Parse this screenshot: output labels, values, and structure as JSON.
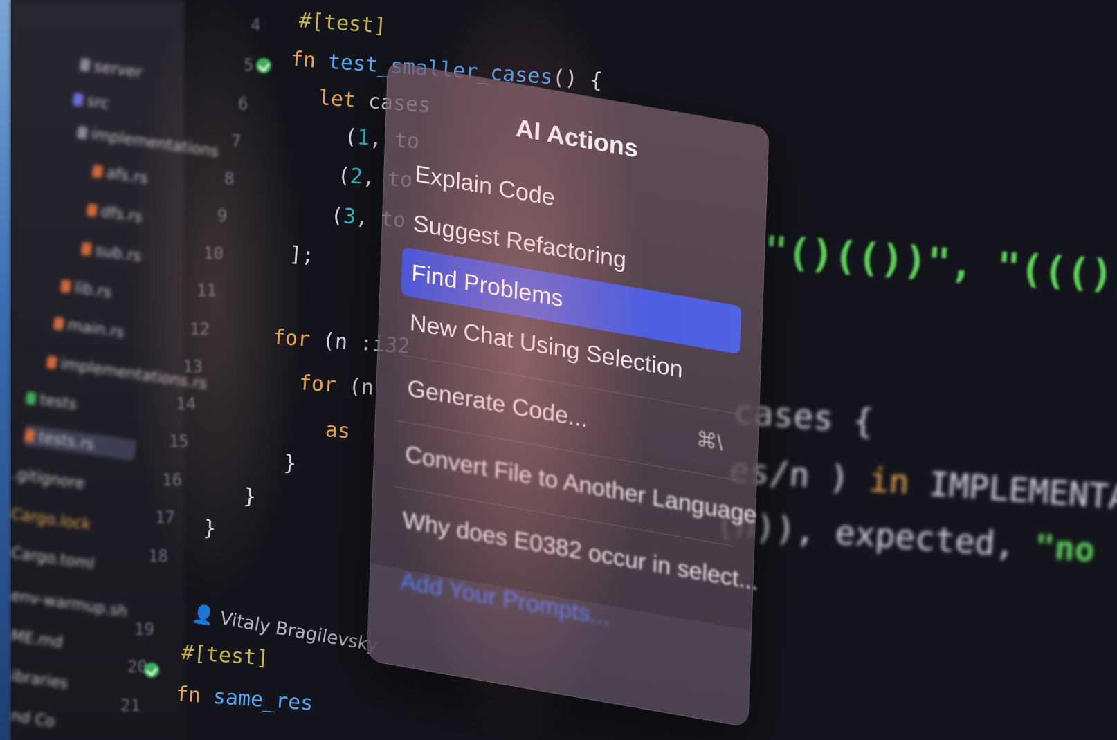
{
  "tree": {
    "items": [
      {
        "label": "server"
      },
      {
        "label": "src"
      },
      {
        "label": "implementations"
      },
      {
        "label": "afs.rs"
      },
      {
        "label": "dfs.rs"
      },
      {
        "label": "sub.rs"
      },
      {
        "label": "lib.rs"
      },
      {
        "label": "main.rs"
      },
      {
        "label": "implementations.rs"
      },
      {
        "label": "tests"
      },
      {
        "label": "tests.rs"
      },
      {
        "label": ".gitignore"
      },
      {
        "label": "Cargo.lock"
      },
      {
        "label": "Cargo.toml"
      },
      {
        "label": "env-warmup.sh"
      },
      {
        "label": "ME.md"
      },
      {
        "label": "ibraries"
      },
      {
        "label": "nd Co"
      }
    ]
  },
  "gutter": {
    "line_numbers": [
      "4",
      "5",
      "6",
      "7",
      "8",
      "9",
      "10",
      "11",
      "12",
      "13",
      "14",
      "15",
      "16",
      "17",
      "18",
      "19",
      "20",
      "21"
    ]
  },
  "code": {
    "line4_attr": "#[test]",
    "line5_kw": "fn",
    "line5_name": "test_smaller_cases",
    "line5_rest": "() {",
    "line6_kw": "let",
    "line6_rest": " cases",
    "line7_open": "(",
    "line7_num": "1",
    "line7_rest": ", to",
    "line8_open": "(",
    "line8_num": "2",
    "line8_rest": ", to",
    "line9_open": "(",
    "line9_num": "3",
    "line9_rest": ", to",
    "line10": "];",
    "line12_kw": "for",
    "line12_rest": " (n :i32",
    "line13_kw": "for",
    "line13_rest": " (n",
    "line14_kw": "as",
    "line15": "}",
    "line16": "}",
    "line17": "}",
    "right_strings": "\"()(())\", \"((()))\"",
    "right_cases": "cases {",
    "right_impl_a": "es/n ) ",
    "right_impl_in": "in",
    "right_impl_b": " IMPLEMENTA",
    "right_expected": "(n)), expected, ",
    "right_expected_str": "\"no",
    "blame_author": "Vitaly Bragilevsky",
    "line20_attr": "#[test]",
    "line21_kw": "fn",
    "line21_rest": " same_res"
  },
  "popup": {
    "title": "AI Actions",
    "items": [
      {
        "label": "Explain Code"
      },
      {
        "label": "Suggest Refactoring"
      },
      {
        "label": "Find Problems"
      },
      {
        "label": "New Chat Using Selection"
      },
      {
        "label": "Generate Code...",
        "shortcut": "⌘\\"
      },
      {
        "label": "Convert File to Another Language"
      },
      {
        "label": "Why does E0382 occur in select..."
      },
      {
        "label": "Add Your Prompts..."
      }
    ]
  },
  "colors": {
    "accent": "#4f63e3",
    "keyword": "#e8a44a",
    "function": "#56a8f5",
    "number": "#2bbac5",
    "string": "#5fd35a",
    "run_marker": "#3fae5a"
  }
}
